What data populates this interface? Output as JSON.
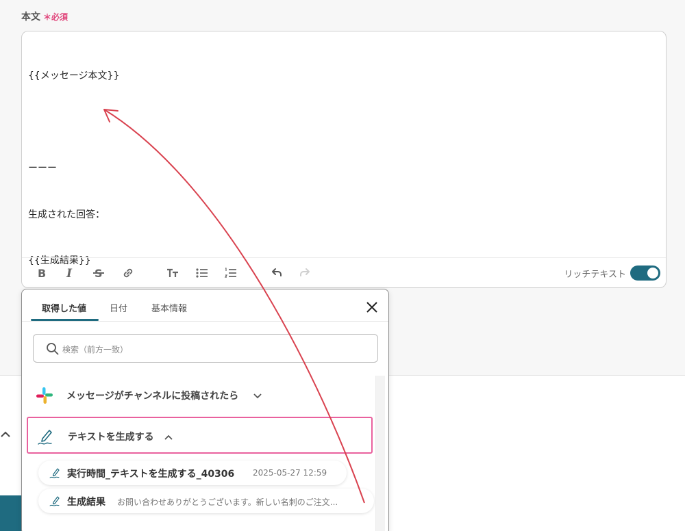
{
  "field": {
    "label": "本文",
    "required_mark": "＊",
    "required_text": "必須",
    "body_lines": [
      "{{メッセージ本文}}",
      "",
      "ーーー",
      "生成された回答：",
      "{{生成結果}}"
    ]
  },
  "toolbar": {
    "rich_text_label": "リッチテキスト",
    "rich_text_enabled": true
  },
  "panel": {
    "tabs": [
      {
        "label": "取得した値",
        "active": true
      },
      {
        "label": "日付",
        "active": false
      },
      {
        "label": "基本情報",
        "active": false
      }
    ],
    "search_placeholder": "検索（前方一致）",
    "groups": [
      {
        "label": "メッセージがチャンネルに投稿されたら",
        "icon": "slack-icon",
        "expanded": false
      },
      {
        "label": "テキストを生成する",
        "icon": "pen-icon",
        "expanded": true
      }
    ],
    "items": [
      {
        "label": "実行時間_テキストを生成する_40306",
        "value": "2025-05-27 12:59"
      },
      {
        "label": "生成結果",
        "value": "お問い合わせありがとうございます。新しい名刺のご注文..."
      }
    ]
  },
  "colors": {
    "accent": "#1f6b80",
    "required": "#e0457b",
    "selected_border": "#e9619e",
    "annotation_arrow": "#d9424f"
  }
}
